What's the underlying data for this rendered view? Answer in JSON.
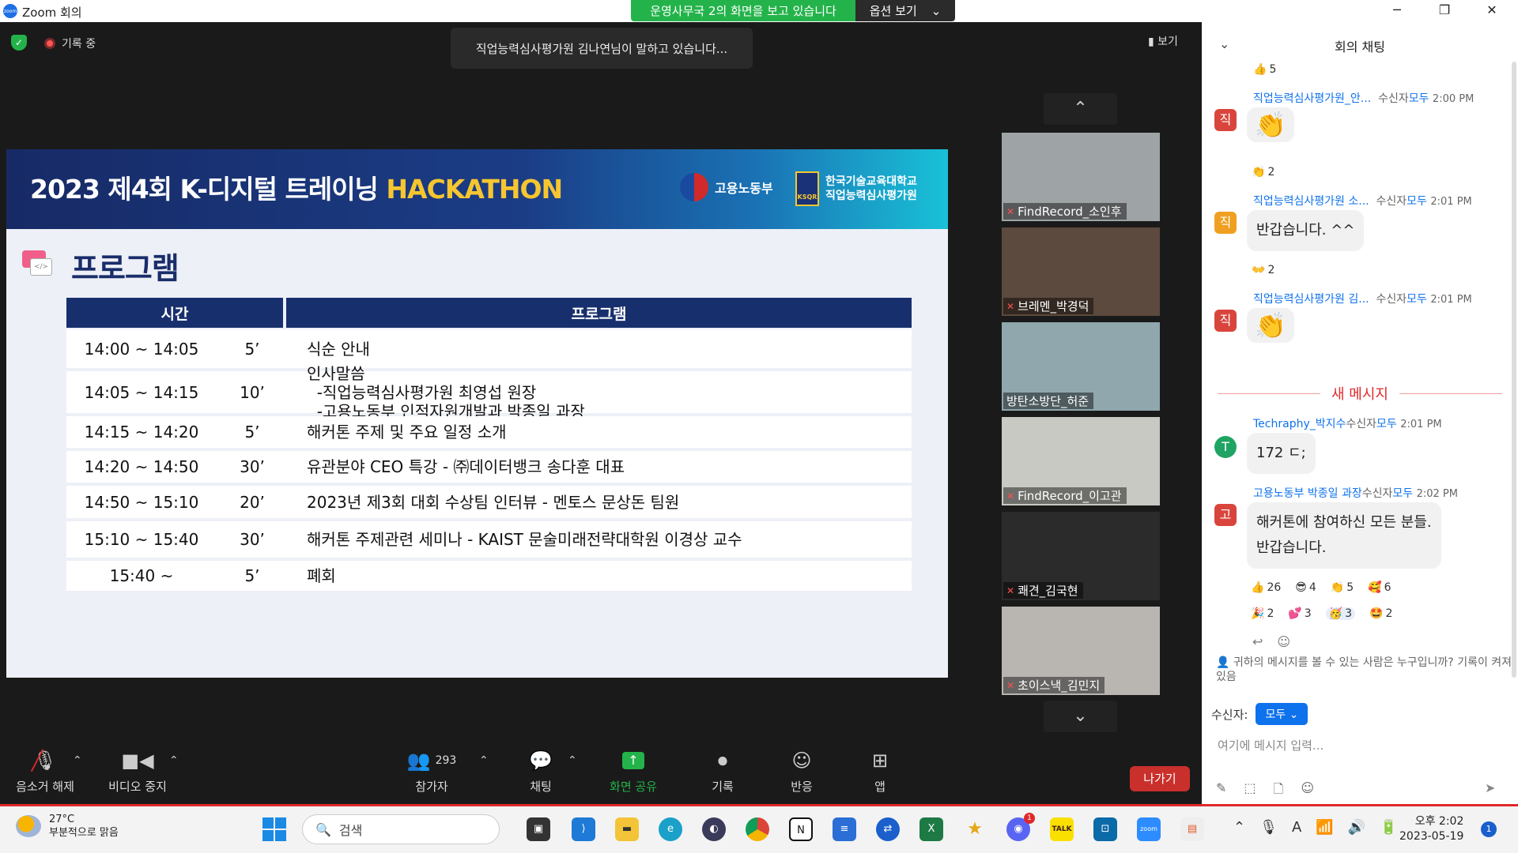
{
  "window": {
    "title": "Zoom 회의",
    "share_banner": "운영사무국 2의 화면을 보고 있습니다",
    "view_options": "옵션 보기",
    "controls": {
      "minimize": "─",
      "maximize": "❐",
      "close": "✕"
    }
  },
  "meeting": {
    "recording_label": "기록 중",
    "speaking_label": "직업능력심사평가원 김나연님이 말하고 있습니다...",
    "view_button": "보기"
  },
  "slide": {
    "title_prefix": "2023 제4회 K-디지털 트레이닝 ",
    "title_highlight": "HACKATHON",
    "logo_moel": "고용노동부",
    "logo_koreatech_line1": "한국기술교육대학교",
    "logo_koreatech_line2": "직업능력심사평가원",
    "logo_koreatech_mark": "KSQR",
    "section_heading": "프로그램",
    "table_headers": {
      "time": "시간",
      "program": "프로그램"
    },
    "rows": [
      {
        "time": "14:00 ~ 14:05",
        "duration": "5’",
        "program": "식순 안내"
      },
      {
        "time": "14:05 ~ 14:15",
        "duration": "10’",
        "program": "인사말씀\n  -직업능력심사평가원 최영섭 원장\n  -고용노동부 인적자원개발과 박종일 과장"
      },
      {
        "time": "14:15 ~ 14:20",
        "duration": "5’",
        "program": "해커톤 주제 및 주요 일정 소개"
      },
      {
        "time": "14:20 ~ 14:50",
        "duration": "30’",
        "program": "유관분야 CEO 특강 - ㈜데이터뱅크 송다훈 대표"
      },
      {
        "time": "14:50 ~ 15:10",
        "duration": "20’",
        "program": "2023년 제3회 대회 수상팀 인터뷰 - 멘토스 문상돈 팀원"
      },
      {
        "time": "15:10 ~ 15:40",
        "duration": "30’",
        "program": "해커톤 주제관련 세미나 - KAIST 문술미래전략대학원 이경상 교수"
      },
      {
        "time": "15:40 ~",
        "duration": "5’",
        "program": "폐회"
      }
    ]
  },
  "participants": [
    {
      "name": "FindRecord_소인후",
      "bg": "#9ea3a6"
    },
    {
      "name": "브레멘_박경덕",
      "bg": "#5b4a3d"
    },
    {
      "name": "방탄소방단_허준",
      "bg": "#8fa7ad"
    },
    {
      "name": "FindRecord_이고관",
      "bg": "#c9c9c4"
    },
    {
      "name": "쾌견_김국현",
      "bg": "#2b2b2b"
    },
    {
      "name": "초이스낵_김민지",
      "bg": "#b9b6b2"
    }
  ],
  "toolbar": {
    "unmute": "음소거 해제",
    "stop_video": "비디오 중지",
    "participants": "참가자",
    "participant_count": "293",
    "chat": "채팅",
    "share_screen": "화면 공유",
    "record": "기록",
    "reactions": "반응",
    "apps": "앱",
    "leave": "나가기"
  },
  "chat": {
    "title": "회의 채팅",
    "top_reaction": {
      "emoji": "👍",
      "count": "5"
    },
    "messages": [
      {
        "sender": "직업능력심사평가원_안...",
        "to": "수신자",
        "audience": "모두",
        "time": "2:00 PM",
        "avatar": "직",
        "avatar_color": "#d9453c",
        "text": "👏",
        "reaction_emoji": "👏",
        "reaction_count": "2"
      },
      {
        "sender": "직업능력심사평가원 소...",
        "to": "수신자",
        "audience": "모두",
        "time": "2:01 PM",
        "avatar": "직",
        "avatar_color": "#f0a020",
        "text": "반갑습니다. ^^",
        "reaction_emoji": "👐",
        "reaction_count": "2"
      },
      {
        "sender": "직업능력심사평가원 김...",
        "to": "수신자",
        "audience": "모두",
        "time": "2:01 PM",
        "avatar": "직",
        "avatar_color": "#d9453c",
        "text": "👏"
      }
    ],
    "new_messages_label": "새 메시지",
    "new_messages": [
      {
        "sender": "Techraphy_박지수",
        "to": "수신자",
        "audience": "모두",
        "time": "2:01 PM",
        "avatar": "T",
        "avatar_color": "#1fa463",
        "text": "172 ㄷ;"
      },
      {
        "sender": "고용노동부 박종일 과장",
        "to": "수신자",
        "audience": "모두",
        "time": "2:02 PM",
        "avatar": "고",
        "avatar_color": "#d9453c",
        "text_line1": "해커톤에 참여하신 모든 분들.",
        "text_line2": "반갑습니다."
      }
    ],
    "reactions_row1": [
      {
        "emoji": "👍",
        "count": "26"
      },
      {
        "emoji": "😎",
        "count": "4"
      },
      {
        "emoji": "👏",
        "count": "5"
      },
      {
        "emoji": "🥰",
        "count": "6"
      }
    ],
    "reactions_row2": [
      {
        "emoji": "🎉",
        "count": "2"
      },
      {
        "emoji": "💕",
        "count": "3"
      },
      {
        "emoji": "🥳",
        "count": "3"
      },
      {
        "emoji": "🤩",
        "count": "2"
      }
    ],
    "privacy_note": "귀하의 메시지를 볼 수 있는 사람은 누구입니까? 기록이 켜져 있음",
    "to_label": "수신자:",
    "to_value": "모두",
    "input_placeholder": "여기에 메시지 입력..."
  },
  "taskbar": {
    "temperature": "27°C",
    "weather_desc": "부분적으로 맑음",
    "search_placeholder": "검색",
    "time": "오후 2:02",
    "date": "2023-05-19",
    "notification_count": "1",
    "discord_badge": "1"
  }
}
